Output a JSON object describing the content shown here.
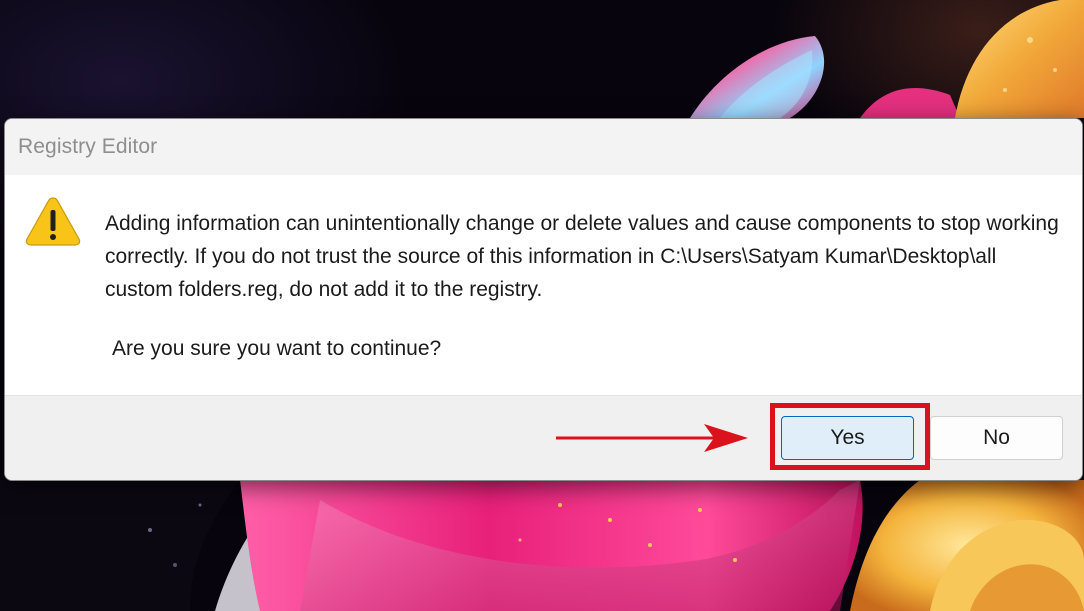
{
  "window": {
    "title": "Registry Editor"
  },
  "dialog": {
    "icon": "warning-triangle-icon",
    "message": "Adding information can unintentionally change or delete values and cause components to stop working correctly. If you do not trust the source of this information in C:\\Users\\Satyam Kumar\\Desktop\\all custom folders.reg, do not add it to the registry.",
    "question": "Are you sure you want to continue?",
    "buttons": {
      "yes": "Yes",
      "no": "No"
    },
    "default_button": "yes"
  },
  "annotations": {
    "highlight_target": "yes-button",
    "arrow_target": "yes-button",
    "color": "#d9121b"
  },
  "colors": {
    "accent": "#0067c0",
    "warning_fill": "#f7c417",
    "annotation_red": "#d9121b"
  }
}
